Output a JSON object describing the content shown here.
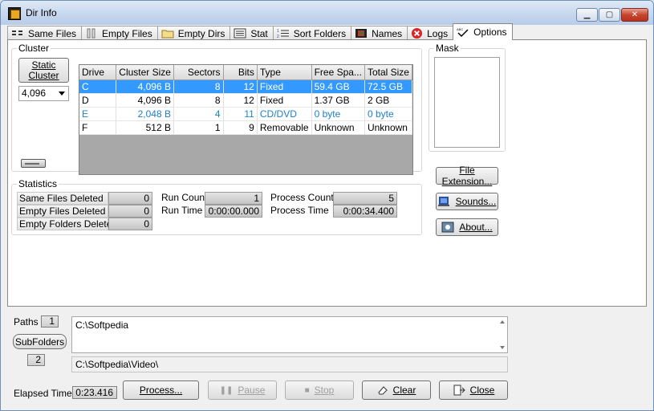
{
  "window": {
    "title": "Dir Info"
  },
  "tabs": [
    {
      "label": "Same Files"
    },
    {
      "label": "Empty Files"
    },
    {
      "label": "Empty Dirs"
    },
    {
      "label": "Stat"
    },
    {
      "label": "Sort Folders"
    },
    {
      "label": "Names"
    },
    {
      "label": "Logs"
    },
    {
      "label": "Options"
    }
  ],
  "cluster": {
    "group_label": "Cluster",
    "static_button": "Static Cluster",
    "size_select": "4,096",
    "columns": [
      "Drive",
      "Cluster Size",
      "Sectors",
      "Bits",
      "Type",
      "Free Spa...",
      "Total Size"
    ],
    "rows": [
      [
        "C",
        "4,096 B",
        "8",
        "12",
        "Fixed",
        "59.4 GB",
        "72.5 GB"
      ],
      [
        "D",
        "4,096 B",
        "8",
        "12",
        "Fixed",
        "1.37 GB",
        "2 GB"
      ],
      [
        "E",
        "2,048 B",
        "4",
        "11",
        "CD/DVD",
        "0 byte",
        "0 byte"
      ],
      [
        "F",
        "512 B",
        "1",
        "9",
        "Removable",
        "Unknown",
        "Unknown"
      ]
    ]
  },
  "mask": {
    "group_label": "Mask"
  },
  "statistics": {
    "group_label": "Statistics",
    "same_files_deleted_label": "Same Files Deleted",
    "same_files_deleted": "0",
    "empty_files_deleted_label": "Empty Files Deleted",
    "empty_files_deleted": "0",
    "empty_folders_deleted_label": "Empty Folders Deleted",
    "empty_folders_deleted": "0",
    "run_count_label": "Run Count",
    "run_count": "1",
    "run_time_label": "Run Time",
    "run_time": "0:00:00.000",
    "process_count_label": "Process Count",
    "process_count": "5",
    "process_time_label": "Process Time",
    "process_time": "0:00:34.400"
  },
  "side_buttons": {
    "file_extension": "File Extension...",
    "sounds": "Sounds...",
    "about": "About..."
  },
  "bottom": {
    "paths_label": "Paths",
    "paths_count": "1",
    "subfolders_button": "SubFolders",
    "subfolders_count": "2",
    "path_value": "C:\\Softpedia",
    "subfolder_value": "C:\\Softpedia\\Video\\",
    "elapsed_label": "Elapsed Time",
    "elapsed_value": "0:23.416",
    "process_button": "Process...",
    "pause_button": "Pause",
    "stop_button": "Stop",
    "clear_button": "Clear",
    "close_button": "Close"
  },
  "colors": {
    "selection": "#3399ff",
    "cd_row_text": "#2080c8",
    "logs_icon": "#d8262b"
  }
}
